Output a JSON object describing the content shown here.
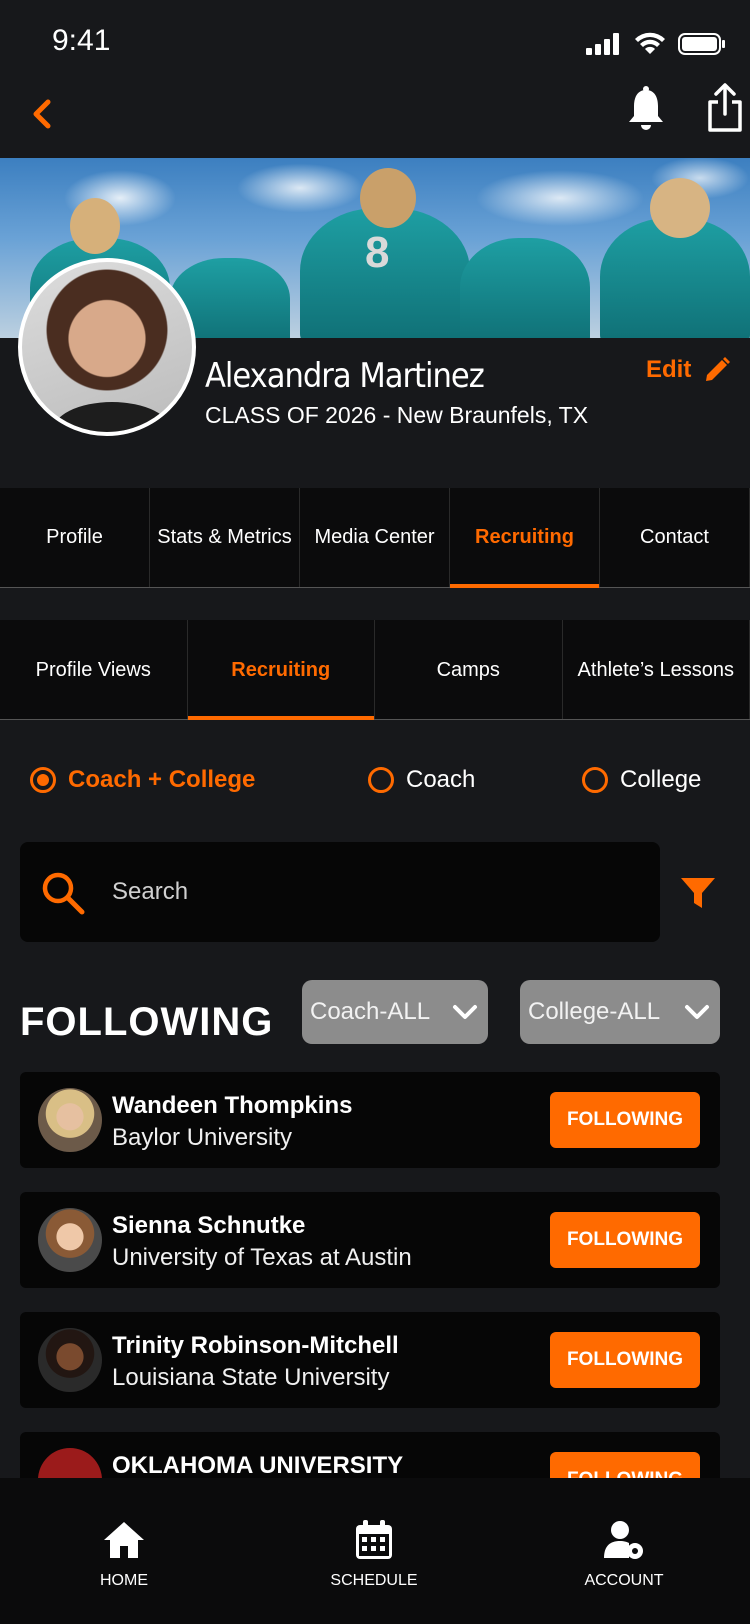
{
  "status_bar": {
    "time": "9:41"
  },
  "profile": {
    "name": "Alexandra Martinez",
    "subtitle": "CLASS OF 2026 - New Braunfels, TX",
    "edit_label": "Edit"
  },
  "main_tabs": [
    {
      "label": "Profile",
      "active": false
    },
    {
      "label": "Stats & Metrics",
      "active": false
    },
    {
      "label": "Media Center",
      "active": false
    },
    {
      "label": "Recruiting",
      "active": true
    },
    {
      "label": "Contact",
      "active": false
    }
  ],
  "sub_tabs": [
    {
      "label": "Profile Views",
      "active": false
    },
    {
      "label": "Recruiting",
      "active": true
    },
    {
      "label": "Camps",
      "active": false
    },
    {
      "label": "Athlete’s Lessons",
      "active": false
    }
  ],
  "filter_radio": {
    "options": [
      "Coach + College",
      "Coach",
      "College"
    ],
    "selected": "Coach + College"
  },
  "search": {
    "placeholder": "Search"
  },
  "following": {
    "title": "FOLLOWING",
    "coach_dropdown": "Coach-ALL",
    "college_dropdown": "College-ALL",
    "items": [
      {
        "name": "Wandeen Thompkins",
        "school": "Baylor University",
        "button": "FOLLOWING"
      },
      {
        "name": "Sienna Schnutke",
        "school": "University of Texas at Austin",
        "button": "FOLLOWING"
      },
      {
        "name": "Trinity Robinson-Mitchell",
        "school": "Louisiana State University",
        "button": "FOLLOWING"
      },
      {
        "name": "OKLAHOMA UNIVERSITY",
        "school": "",
        "button": "FOLLOWING"
      }
    ]
  },
  "bottom_nav": [
    {
      "label": "HOME",
      "icon": "home-icon"
    },
    {
      "label": "SCHEDULE",
      "icon": "calendar-icon"
    },
    {
      "label": "ACCOUNT",
      "icon": "account-settings-icon"
    }
  ],
  "colors": {
    "accent": "#ff6a00",
    "background": "#17181b",
    "card": "#060606"
  }
}
